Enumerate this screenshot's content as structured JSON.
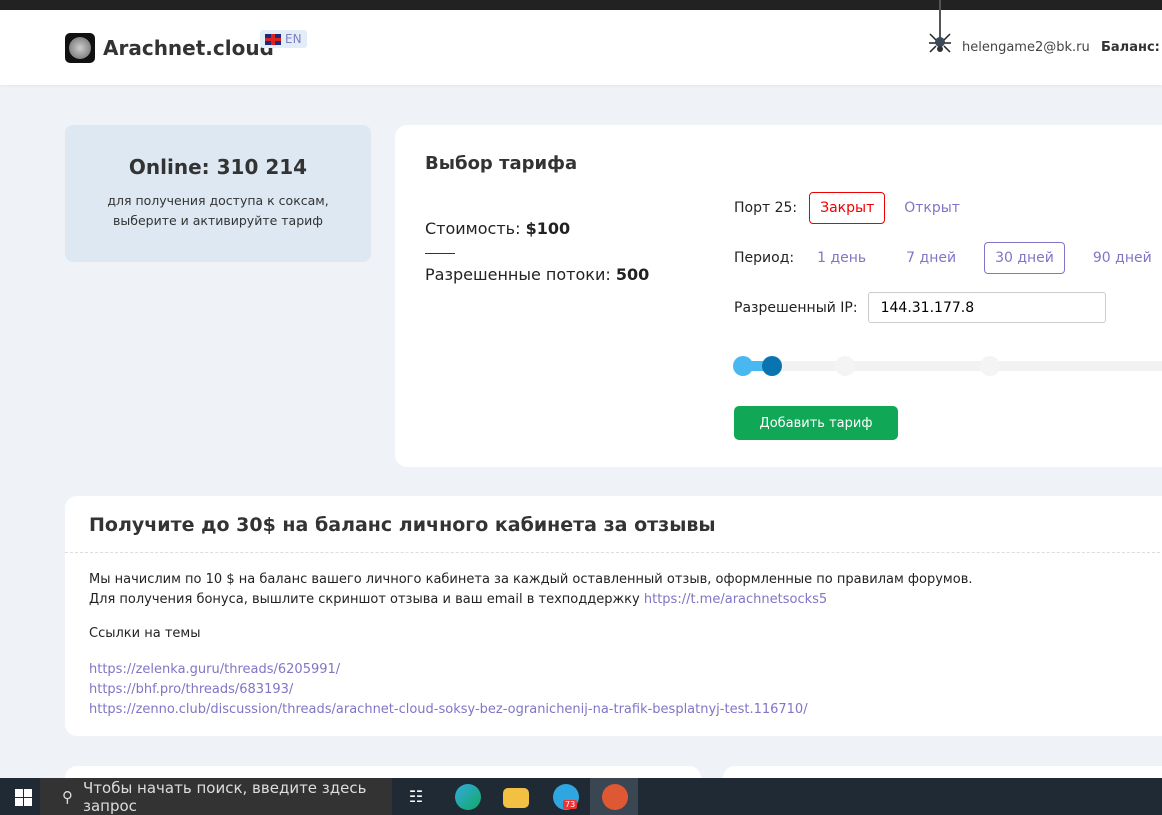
{
  "header": {
    "brand": "Arachnet.cloud",
    "lang": "EN",
    "email": "helengame2@bk.ru",
    "balance": "Баланс: $"
  },
  "online": {
    "title": "Online: 310 214",
    "text": "для получения доступа к соксам, выберите и активируйте тариф"
  },
  "tariff": {
    "title": "Выбор тарифа",
    "cost_label": "Стоимость:",
    "cost_value": "$100",
    "threads_label": "Разрешенные потоки:",
    "threads_value": "500",
    "port_label": "Порт 25:",
    "port_options": [
      "Закрыт",
      "Открыт"
    ],
    "port_selected": "Закрыт",
    "period_label": "Период:",
    "period_options": [
      "1 день",
      "7 дней",
      "30 дней",
      "90 дней"
    ],
    "period_selected": "30 дней",
    "ip_label": "Разрешенный IP:",
    "ip_value": "144.31.177.8",
    "slider_step": 2,
    "add_button": "Добавить тариф"
  },
  "bonus": {
    "title": "Получите до 30$ на баланс личного кабинета за отзывы",
    "line1": "Мы начислим по 10 $ на баланс вашего личного кабинета за каждый оставленный отзыв, оформленные по правилам форумов.",
    "line2": "Для получения бонуса, вышлите скриншот отзыва и ваш email в техподдержку",
    "support_link": "https://t.me/arachnetsocks5",
    "links_title": "Ссылки на темы",
    "links": [
      "https://zelenka.guru/threads/6205991/",
      "https://bhf.pro/threads/683193/",
      "https://zenno.club/discussion/threads/arachnet-cloud-soksy-bez-ogranichenij-na-trafik-besplatnyj-test.116710/"
    ]
  },
  "taskbar": {
    "search_placeholder": "Чтобы начать поиск, введите здесь запрос",
    "telegram_badge": "73"
  },
  "colors": {
    "accent": "#7f76c6",
    "green": "#10a756",
    "red": "#ee0000"
  }
}
